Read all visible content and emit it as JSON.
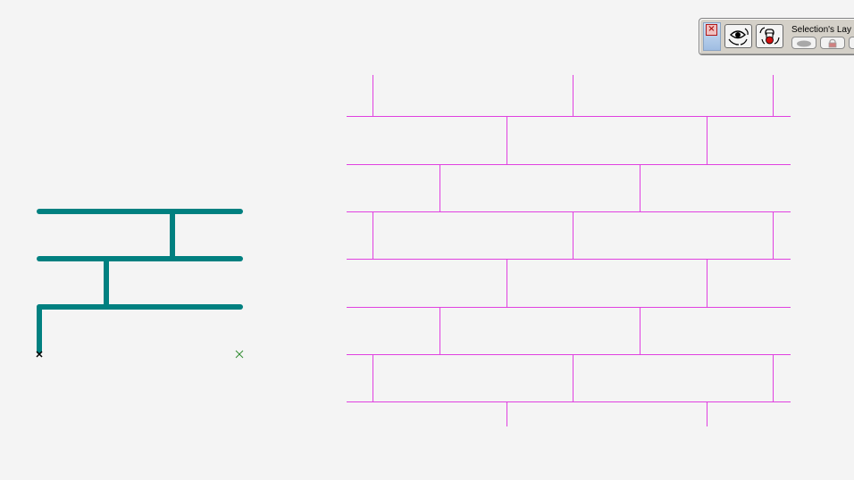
{
  "palette": {
    "title": "Selection's Lay",
    "close_label": "×"
  },
  "colors": {
    "background": "#f4f4f4",
    "drawn_wall": "#008080",
    "hatch_lines": "#e040e0",
    "marker_start": "#000000",
    "marker_end": "#2e8b2e",
    "palette_bg": "#d4d0c8"
  },
  "icons": {
    "close": "close-icon",
    "view": "eye-cycle-icon",
    "lock": "lock-cycle-icon",
    "visibility": "eye-icon",
    "lock_small": "lock-icon"
  }
}
